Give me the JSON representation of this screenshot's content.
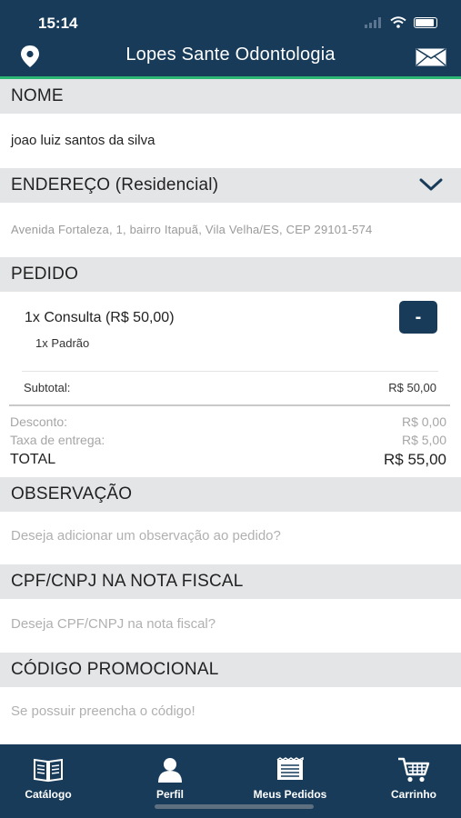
{
  "status_bar": {
    "time": "15:14"
  },
  "header": {
    "title": "Lopes Sante Odontologia",
    "location_icon": "map-pin-icon",
    "mail_icon": "envelope-icon"
  },
  "colors": {
    "navy": "#173b59",
    "accent_green": "#2bb673",
    "section_bg": "#e4e5e7"
  },
  "sections": {
    "nome": {
      "title": "NOME",
      "value": "joao luiz santos da silva"
    },
    "endereco": {
      "title": "ENDEREÇO (Residencial)",
      "value": "Avenida Fortaleza, 1, bairro Itapuã, Vila Velha/ES, CEP 29101-574"
    },
    "pedido": {
      "title": "PEDIDO",
      "item": {
        "title": "1x Consulta (R$ 50,00)",
        "sub": "1x Padrão",
        "remove_label": "-"
      },
      "subtotal_label": "Subtotal:",
      "subtotal_value": "R$ 50,00",
      "desconto_label": "Desconto:",
      "desconto_value": "R$ 0,00",
      "taxa_label": "Taxa de entrega:",
      "taxa_value": "R$ 5,00",
      "total_label": "TOTAL",
      "total_value": "R$ 55,00"
    },
    "observacao": {
      "title": "OBSERVAÇÃO",
      "placeholder": "Deseja adicionar um observação ao pedido?"
    },
    "cpf": {
      "title": "CPF/CNPJ NA NOTA FISCAL",
      "placeholder": "Deseja CPF/CNPJ na nota fiscal?"
    },
    "promo": {
      "title": "CÓDIGO PROMOCIONAL",
      "placeholder": "Se possuir preencha o código!"
    }
  },
  "tabs": [
    {
      "label": "Catálogo",
      "icon": "book-icon"
    },
    {
      "label": "Perfil",
      "icon": "user-icon"
    },
    {
      "label": "Meus Pedidos",
      "icon": "receipt-icon"
    },
    {
      "label": "Carrinho",
      "icon": "cart-icon"
    }
  ]
}
